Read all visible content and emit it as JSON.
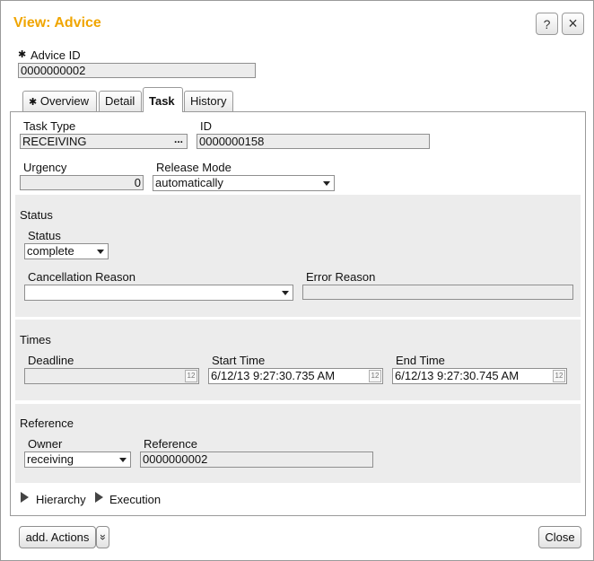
{
  "dialog": {
    "title": "View: Advice",
    "help_icon": "?",
    "close_icon": "×"
  },
  "advice": {
    "label": "Advice ID",
    "required_mark": "✱",
    "value": "0000000002"
  },
  "tabs": [
    {
      "label": "Overview",
      "mark": "✱",
      "active": false
    },
    {
      "label": "Detail",
      "active": false
    },
    {
      "label": "Task",
      "active": true
    },
    {
      "label": "History",
      "active": false
    }
  ],
  "task": {
    "type_label": "Task Type",
    "type_value": "RECEIVING",
    "type_button": "...",
    "id_label": "ID",
    "id_value": "0000000158",
    "urgency_label": "Urgency",
    "urgency_value": "0",
    "release_label": "Release Mode",
    "release_value": "automatically"
  },
  "status_group": {
    "title": "Status",
    "status_label": "Status",
    "status_value": "complete",
    "cancel_label": "Cancellation Reason",
    "cancel_value": "",
    "error_label": "Error Reason",
    "error_value": ""
  },
  "times_group": {
    "title": "Times",
    "deadline_label": "Deadline",
    "deadline_value": "",
    "start_label": "Start Time",
    "start_value": "6/12/13 9:27:30.735 AM",
    "end_label": "End Time",
    "end_value": "6/12/13 9:27:30.745 AM",
    "calendar_glyph": "12"
  },
  "reference_group": {
    "title": "Reference",
    "owner_label": "Owner",
    "owner_value": "receiving",
    "ref_label": "Reference",
    "ref_value": "0000000002"
  },
  "sections": {
    "hierarchy": "Hierarchy",
    "execution": "Execution"
  },
  "footer": {
    "actions_label": "add. Actions",
    "more_glyph": "»",
    "close_label": "Close"
  },
  "colors": {
    "title": "#f0a500",
    "group_bg": "#ececec"
  }
}
